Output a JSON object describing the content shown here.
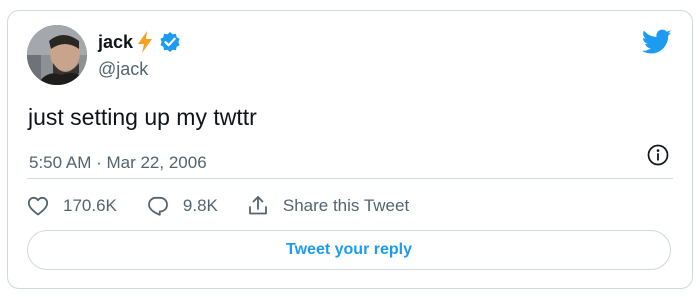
{
  "author": {
    "name": "jack",
    "handle": "@jack",
    "verified": true,
    "name_emoji": "lightning-bolt"
  },
  "tweet": {
    "text": "just setting up my twttr",
    "timestamp": "5:50 AM · Mar 22, 2006"
  },
  "actions": {
    "likes": "170.6K",
    "replies": "9.8K",
    "share_label": "Share this Tweet"
  },
  "reply_button": {
    "label": "Tweet your reply"
  },
  "icons": {
    "brand": "twitter-bird-icon",
    "info": "info-icon",
    "like": "heart-icon",
    "reply": "reply-bubble-icon",
    "share": "share-icon",
    "verified": "verified-badge-icon"
  },
  "colors": {
    "accent": "#1d9bf0",
    "text": "#0f1419",
    "secondary": "#536471",
    "border": "#cfd9de",
    "bolt": "#f4a223"
  }
}
